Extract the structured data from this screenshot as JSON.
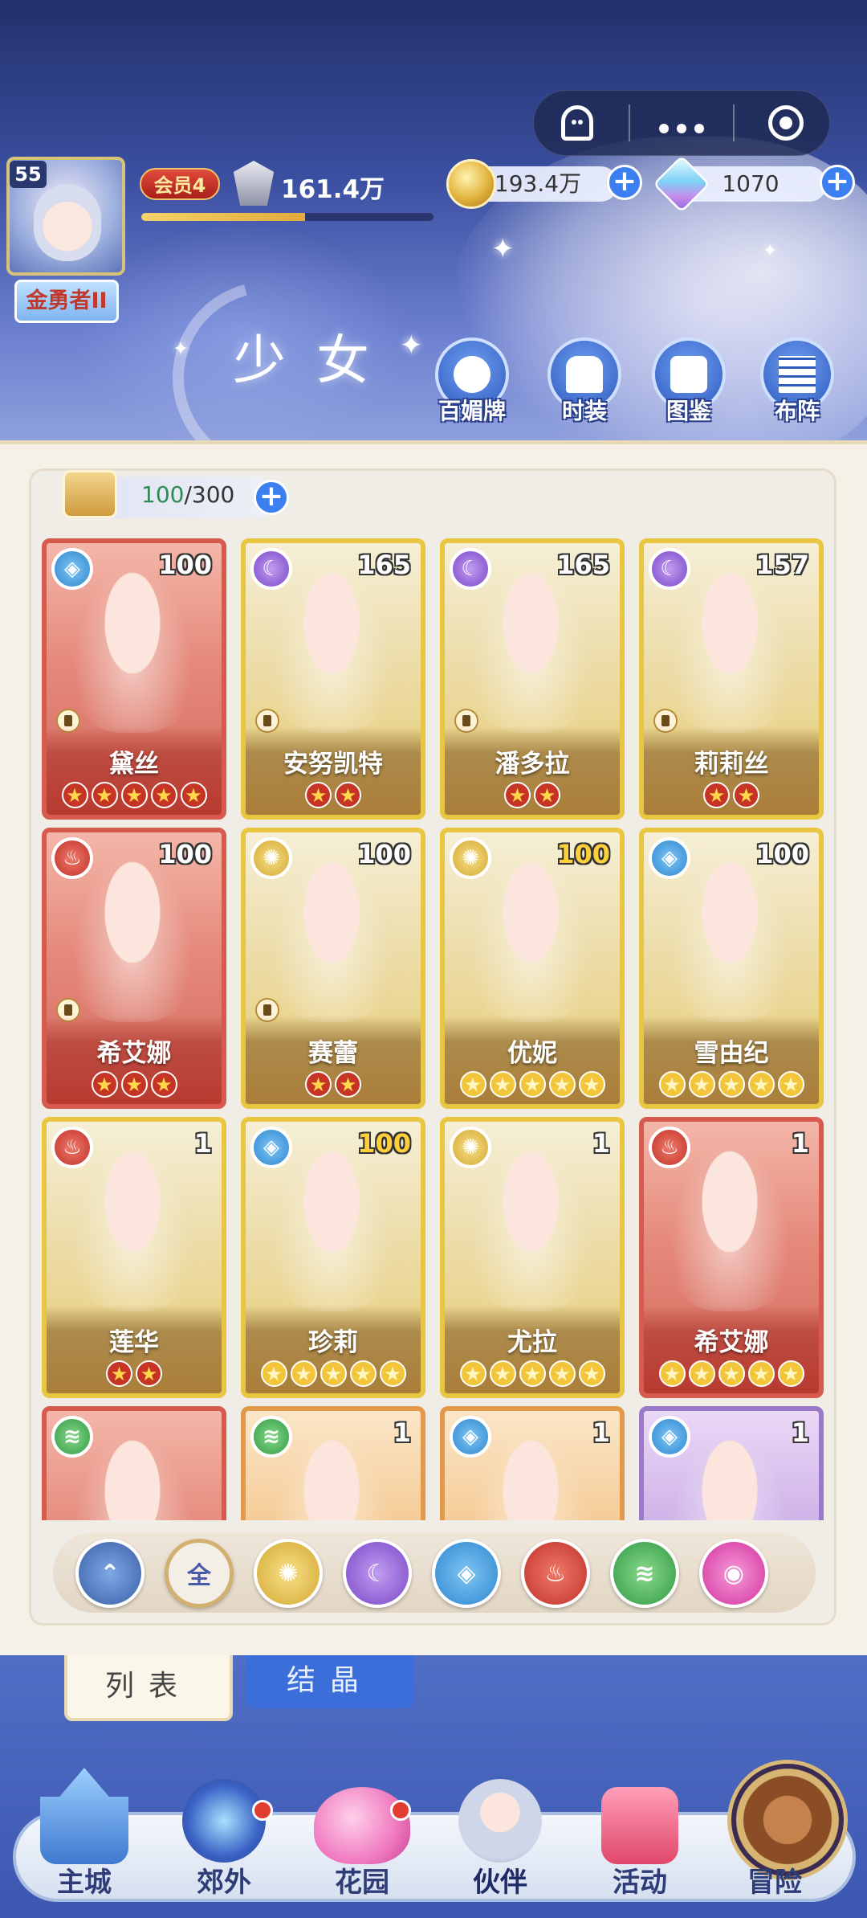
{
  "header": {
    "level": "55",
    "title_badge": "金勇者II",
    "vip": "会员4",
    "power": "161.4万",
    "exp_progress": 0.56,
    "gold": "193.4万",
    "gems": "1070",
    "page_title": "少女",
    "buttons": [
      {
        "label": "百媚牌",
        "icon": "card-deck-icon"
      },
      {
        "label": "时装",
        "icon": "outfit-icon"
      },
      {
        "label": "图鉴",
        "icon": "book-icon"
      },
      {
        "label": "布阵",
        "icon": "formation-grid-icon"
      }
    ],
    "capsule": {
      "icons": [
        "ghost-icon",
        "more-dots-icon",
        "target-icon"
      ]
    }
  },
  "capacity": {
    "current": "100",
    "max": "/300"
  },
  "cards": [
    {
      "name": "黛丝",
      "level": "100",
      "element": "water",
      "frame": "red",
      "stars": 5,
      "star_color": "red",
      "rook": true
    },
    {
      "name": "安努凯特",
      "level": "165",
      "element": "moon",
      "frame": "gold",
      "stars": 2,
      "star_color": "red",
      "rook": true
    },
    {
      "name": "潘多拉",
      "level": "165",
      "element": "moon",
      "frame": "gold",
      "stars": 2,
      "star_color": "red",
      "rook": true
    },
    {
      "name": "莉莉丝",
      "level": "157",
      "element": "moon",
      "frame": "gold",
      "stars": 2,
      "star_color": "red",
      "rook": true
    },
    {
      "name": "希艾娜",
      "level": "100",
      "element": "fire",
      "frame": "red",
      "stars": 3,
      "star_color": "red",
      "rook": true
    },
    {
      "name": "赛蕾",
      "level": "100",
      "element": "sun",
      "frame": "gold",
      "stars": 2,
      "star_color": "red",
      "rook": true
    },
    {
      "name": "优妮",
      "level": "100",
      "element": "sun",
      "frame": "gold",
      "stars": 5,
      "star_color": "gold",
      "rook": false,
      "level_max": true
    },
    {
      "name": "雪由纪",
      "level": "100",
      "element": "water",
      "frame": "gold",
      "stars": 5,
      "star_color": "gold",
      "rook": false
    },
    {
      "name": "莲华",
      "level": "1",
      "element": "fire",
      "frame": "gold",
      "stars": 2,
      "star_color": "red",
      "rook": false
    },
    {
      "name": "珍莉",
      "level": "100",
      "element": "water",
      "frame": "gold",
      "stars": 5,
      "star_color": "gold",
      "rook": false,
      "level_max": true
    },
    {
      "name": "尤拉",
      "level": "1",
      "element": "sun",
      "frame": "gold",
      "stars": 5,
      "star_color": "gold",
      "rook": false
    },
    {
      "name": "希艾娜",
      "level": "1",
      "element": "fire",
      "frame": "red",
      "stars": 5,
      "star_color": "gold",
      "rook": false
    },
    {
      "name": "",
      "level": "",
      "element": "wind",
      "frame": "red",
      "stars": 0,
      "star_color": "gold",
      "rook": false
    },
    {
      "name": "",
      "level": "1",
      "element": "wind",
      "frame": "orange",
      "stars": 0,
      "star_color": "gold",
      "rook": false
    },
    {
      "name": "",
      "level": "1",
      "element": "water",
      "frame": "orange",
      "stars": 0,
      "star_color": "gold",
      "rook": false
    },
    {
      "name": "",
      "level": "1",
      "element": "water",
      "frame": "purple",
      "stars": 0,
      "star_color": "gold",
      "rook": false
    }
  ],
  "filter": {
    "all_label": "全",
    "items": [
      "light",
      "all",
      "sun",
      "moon",
      "water",
      "fire",
      "wind",
      "heart"
    ]
  },
  "tabs": [
    {
      "label": "列表",
      "active": true
    },
    {
      "label": "结晶",
      "active": false
    }
  ],
  "nav": [
    {
      "label": "主城",
      "icon": "castle-icon",
      "badge": false
    },
    {
      "label": "郊外",
      "icon": "hexagram-icon",
      "badge": true
    },
    {
      "label": "花园",
      "icon": "heart-icon",
      "badge": true
    },
    {
      "label": "伙伴",
      "icon": "partner-icon",
      "badge": false,
      "active": true
    },
    {
      "label": "活动",
      "icon": "gift-icon",
      "badge": false
    },
    {
      "label": "冒险",
      "icon": "compass-icon",
      "badge": false
    }
  ]
}
